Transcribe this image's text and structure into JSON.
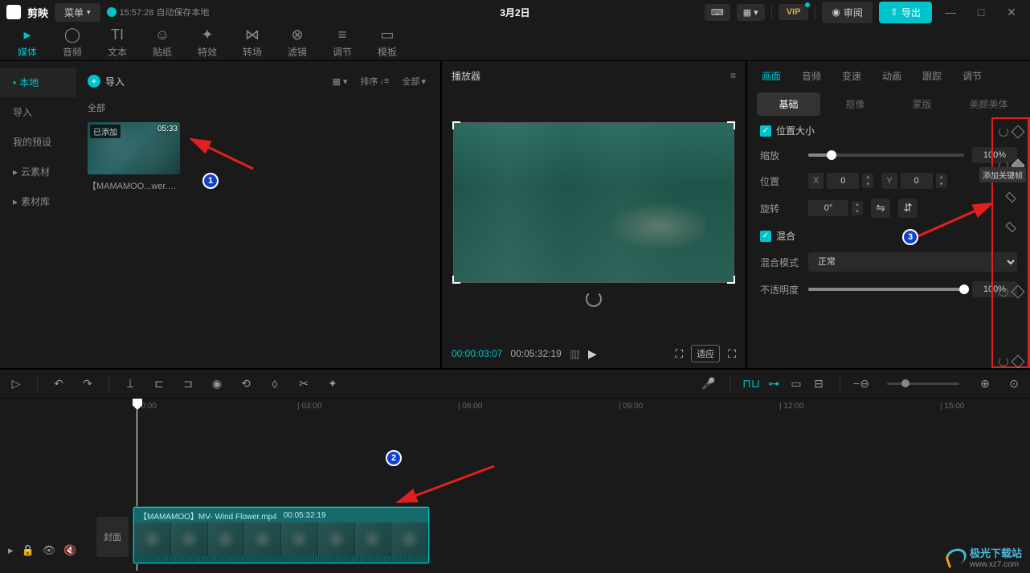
{
  "titlebar": {
    "app_name": "剪映",
    "menu_label": "菜单",
    "autosave_text": "15:57:28 自动保存本地",
    "project_name": "3月2日",
    "vip_label": "VIP",
    "review_label": "审阅",
    "export_label": "导出"
  },
  "top_tabs": {
    "media": "媒体",
    "audio": "音频",
    "text": "文本",
    "sticker": "贴纸",
    "effect": "特效",
    "transition": "转场",
    "filter": "滤镜",
    "adjust": "调节",
    "template": "模板"
  },
  "side_nav": {
    "local": "本地",
    "import": "导入",
    "my_presets": "我的预设",
    "cloud": "云素材",
    "library": "素材库"
  },
  "media": {
    "import_label": "导入",
    "all_label": "全部",
    "sort_label": "排序",
    "filter_all": "全部",
    "clip": {
      "badge": "已添加",
      "duration": "05:33",
      "name": "【MAMAMOO...wer.mp4"
    }
  },
  "player": {
    "title": "播放器",
    "current_time": "00:00:03:07",
    "total_time": "00:05:32:19",
    "fit_label": "适应"
  },
  "right_tabs": {
    "picture": "画面",
    "audio": "音频",
    "speed": "变速",
    "animation": "动画",
    "tracking": "跟踪",
    "adjust": "调节"
  },
  "sub_tabs": {
    "basic": "基础",
    "cutout": "抠像",
    "mask": "蒙版",
    "beauty": "美颜美体"
  },
  "props": {
    "position_size": "位置大小",
    "scale": "缩放",
    "scale_value": "100%",
    "position": "位置",
    "x_label": "X",
    "x_value": "0",
    "y_label": "Y",
    "y_value": "0",
    "rotation": "旋转",
    "rotation_value": "0°",
    "blend": "混合",
    "blend_mode": "混合模式",
    "blend_mode_value": "正常",
    "opacity": "不透明度",
    "opacity_value": "100%",
    "keyframe_tooltip": "添加关键帧"
  },
  "timeline": {
    "ruler": [
      "0:00",
      "03:00",
      "06:00",
      "09:00",
      "12:00",
      "15:00"
    ],
    "cover": "封面",
    "clip_name": "【MAMAMOO】MV- Wind Flower.mp4",
    "clip_duration": "00:05:32:19"
  },
  "annotations": {
    "n1": "1",
    "n2": "2",
    "n3": "3"
  },
  "watermark": {
    "name": "极光下载站",
    "url": "www.xz7.com"
  }
}
